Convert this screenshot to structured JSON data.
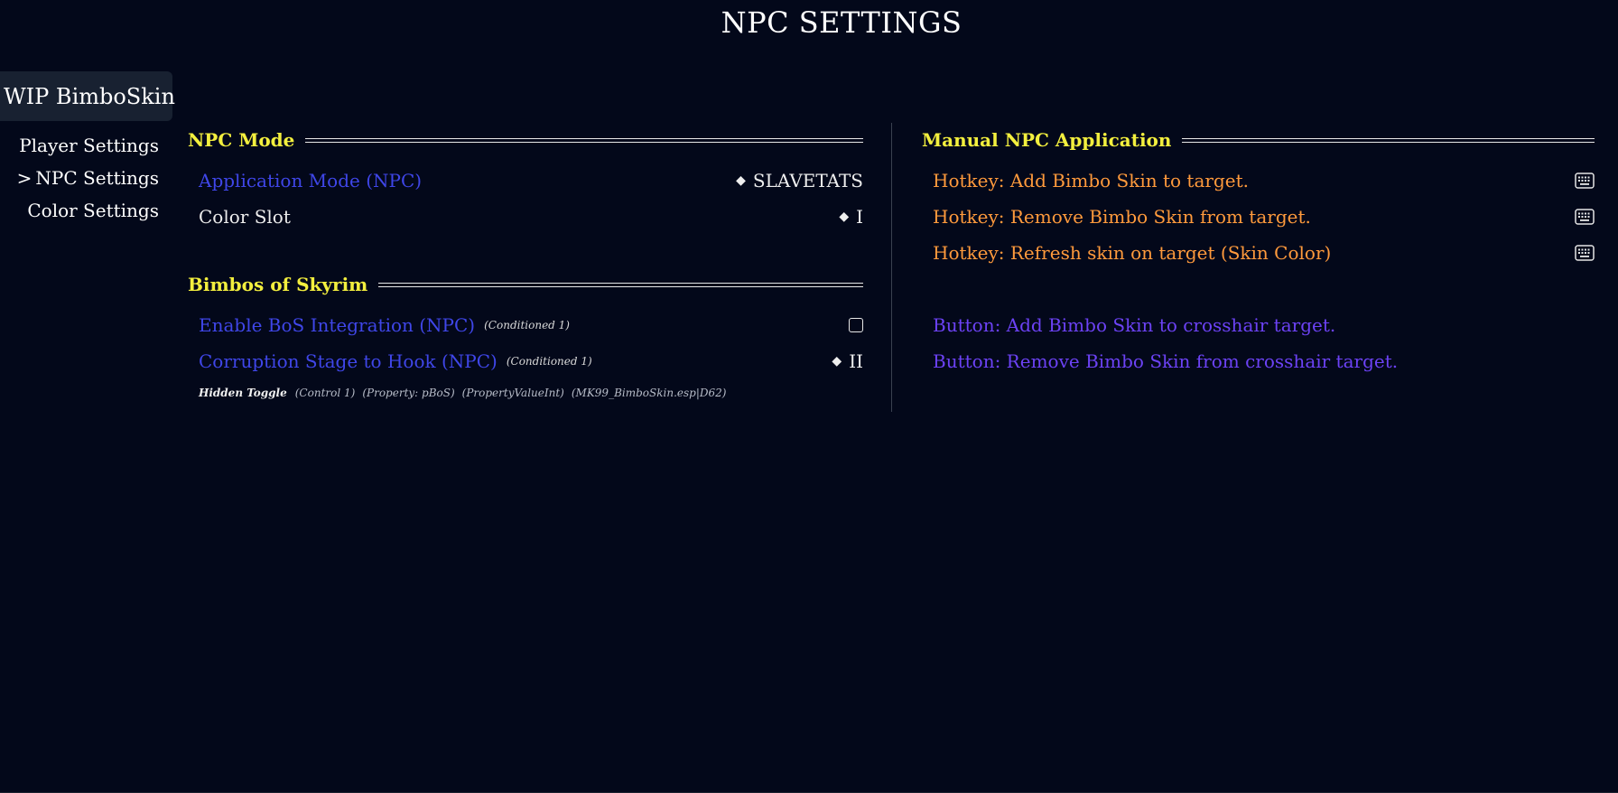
{
  "page": {
    "title": "NPC SETTINGS"
  },
  "mod_tab": {
    "label": "WIP BimboSkin"
  },
  "side_nav": {
    "items": [
      {
        "label": "Player Settings",
        "active": false
      },
      {
        "label": "NPC Settings",
        "active": true,
        "marker": ">"
      },
      {
        "label": "Color Settings",
        "active": false
      }
    ]
  },
  "left": {
    "npc_mode": {
      "header": "NPC Mode",
      "application_mode": {
        "label": "Application Mode (NPC)",
        "value": "SLAVETATS"
      },
      "color_slot": {
        "label": "Color Slot",
        "value": "I"
      }
    },
    "bos": {
      "header": "Bimbos of Skyrim",
      "enable": {
        "label": "Enable BoS Integration (NPC)",
        "condition": "(Conditioned 1)",
        "checked": false
      },
      "corruption": {
        "label": "Corruption Stage to Hook (NPC)",
        "condition": "(Conditioned 1)",
        "value": "II"
      },
      "hidden_toggle": {
        "label": "Hidden Toggle",
        "control": "(Control 1)",
        "property": "(Property: pBoS)",
        "property_type": "(PropertyValueInt)",
        "source": "(MK99_BimboSkin.esp|D62)"
      }
    }
  },
  "right": {
    "manual": {
      "header": "Manual NPC Application",
      "hotkeys": [
        {
          "label": "Hotkey: Add Bimbo Skin to target.",
          "icon": "keyboard-icon"
        },
        {
          "label": "Hotkey: Remove Bimbo Skin from target.",
          "icon": "keyboard-icon"
        },
        {
          "label": "Hotkey: Refresh skin on target (Skin Color)",
          "icon": "keyboard-icon"
        }
      ],
      "buttons": [
        {
          "label": "Button: Add Bimbo Skin to crosshair target."
        },
        {
          "label": "Button: Remove Bimbo Skin from crosshair target."
        }
      ]
    }
  },
  "colors": {
    "background": "#03081a",
    "header": "#f3ef3e",
    "option_blue": "#3f46e8",
    "hotkey_orange": "#ff9a3c",
    "button_violet": "#6c42f5"
  }
}
